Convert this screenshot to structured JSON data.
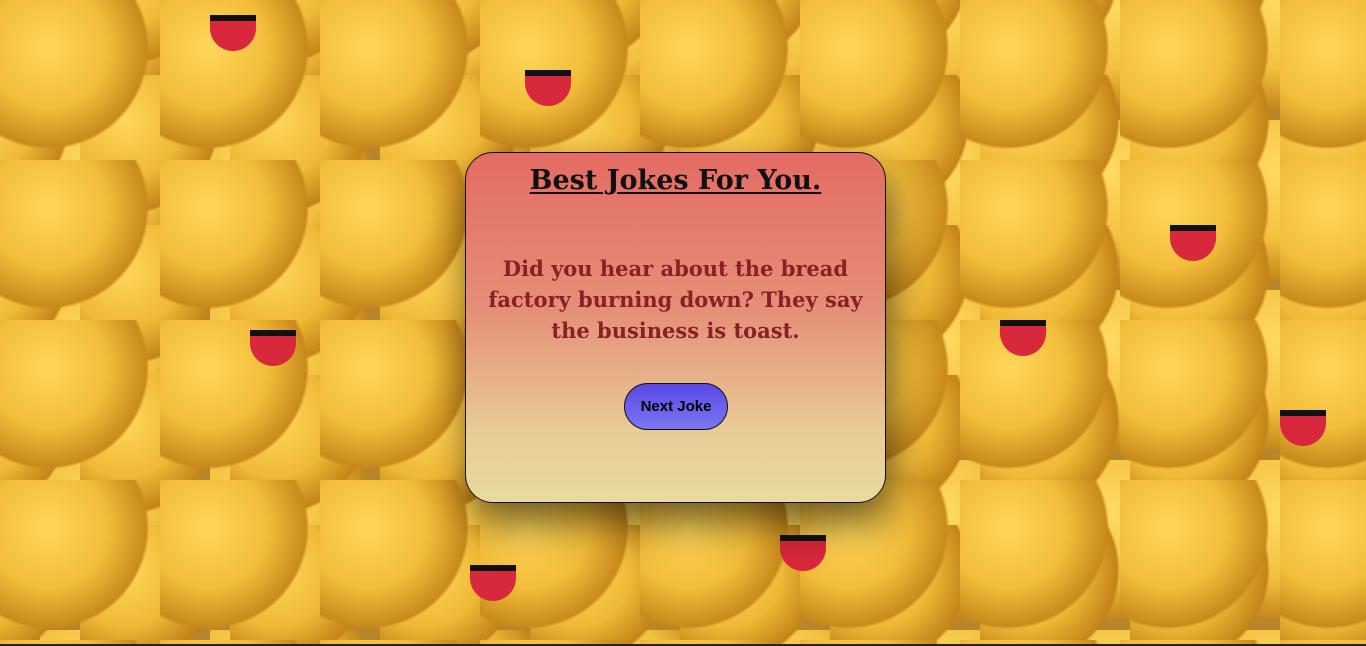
{
  "page": {
    "background_image": "laughing-emoji-balls-icon"
  },
  "card": {
    "title": "Best Jokes For You.",
    "joke": "Did you hear about the bread factory burning down? They say the business is toast.",
    "button_label": "Next Joke"
  },
  "colors": {
    "card_top": "#e46b63",
    "card_bottom": "#e8db9f",
    "joke_text": "#8a1f26",
    "button_top": "#5a48e6",
    "button_bottom": "#7b77f0"
  }
}
